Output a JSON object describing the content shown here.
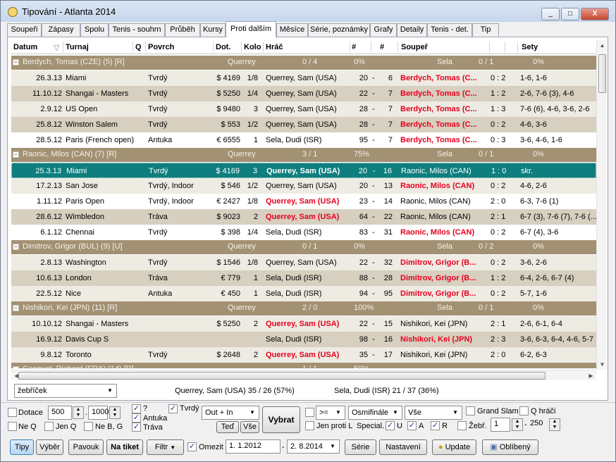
{
  "window": {
    "title": "Tipování - Atlanta 2014",
    "controls": [
      "_",
      "□",
      "X"
    ]
  },
  "tabs": [
    "Soupeři",
    "Zápasy",
    "Spolu",
    "Tenis - souhrn",
    "Průběh",
    "Kursy",
    "Proti dalším",
    "Měsíce",
    "Série, poznámky",
    "Grafy",
    "Detaily",
    "Tenis - det.",
    "Tip"
  ],
  "active_tab": "Proti dalším",
  "columns": [
    "Datum",
    "Turnaj",
    "Q",
    "Povrch",
    "Dot.",
    "Kolo",
    "Hráč",
    "#",
    "#",
    "Soupeř",
    "Sety"
  ],
  "groups": [
    {
      "header": {
        "name": "Berdych, Tomas (CZE) (5) [R]",
        "p1": "Querrey",
        "s1": "0 / 4",
        "pc1": "0%",
        "p2": "Sela",
        "s2": "0 / 1",
        "pc2": "0%"
      },
      "rows": [
        {
          "date": "26.3.13",
          "tour": "Miami",
          "surface": "Tvrdý",
          "prize": "$ 4169",
          "round": "1/8",
          "player": "Querrey, Sam (USA)",
          "n1": "20",
          "n2": "6",
          "opp": "Berdych, Tomas (C...",
          "res": "0  :  2",
          "sets": "1-6, 1-6",
          "opp_red": true,
          "player_red": false,
          "style": "r-a"
        },
        {
          "date": "11.10.12",
          "tour": "Shangai - Masters",
          "surface": "Tvrdý",
          "prize": "$ 5250",
          "round": "1/4",
          "player": "Querrey, Sam (USA)",
          "n1": "22",
          "n2": "7",
          "opp": "Berdych, Tomas (C...",
          "res": "1  :  2",
          "sets": "2-6, 7-6 (3), 4-6",
          "opp_red": true,
          "player_red": false,
          "style": "r-b"
        },
        {
          "date": "2.9.12",
          "tour": "US Open",
          "surface": "Tvrdý",
          "prize": "$ 9480",
          "round": "3",
          "player": "Querrey, Sam (USA)",
          "n1": "28",
          "n2": "7",
          "opp": "Berdych, Tomas (C...",
          "res": "1  :  3",
          "sets": "7-6 (6), 4-6, 3-6, 2-6",
          "opp_red": true,
          "player_red": false,
          "style": "r-a"
        },
        {
          "date": "25.8.12",
          "tour": "Winston Salem",
          "surface": "Tvrdý",
          "prize": "$ 553",
          "round": "1/2",
          "player": "Querrey, Sam (USA)",
          "n1": "28",
          "n2": "7",
          "opp": "Berdych, Tomas (C...",
          "res": "0  :  2",
          "sets": "4-6, 3-6",
          "opp_red": true,
          "player_red": false,
          "style": "r-b"
        },
        {
          "date": "28.5.12",
          "tour": "Paris (French open)",
          "surface": "Antuka",
          "prize": "€ 6555",
          "round": "1",
          "player": "Sela, Dudi (ISR)",
          "n1": "95",
          "n2": "7",
          "opp": "Berdych, Tomas (C...",
          "res": "0  :  3",
          "sets": "3-6, 4-6, 1-6",
          "opp_red": true,
          "player_red": false,
          "style": "r-c"
        }
      ]
    },
    {
      "header": {
        "name": "Raonic, Milos (CAN) (7) [R]",
        "p1": "Querrey",
        "s1": "3 / 1",
        "pc1": "75%",
        "p2": "Sela",
        "s2": "0 / 1",
        "pc2": "0%"
      },
      "rows": [
        {
          "date": "25.3.13",
          "tour": "Miami",
          "surface": "Tvrdý",
          "prize": "$ 4169",
          "round": "3",
          "player": "Querrey, Sam (USA)",
          "n1": "20",
          "n2": "16",
          "opp": "Raonic, Milos (CAN)",
          "res": "1  :  0",
          "sets": "skr.",
          "opp_red": false,
          "player_red": false,
          "player_bold": true,
          "style": "r-sel"
        },
        {
          "date": "17.2.13",
          "tour": "San Jose",
          "surface": "Tvrdý, Indoor",
          "prize": "$ 546",
          "round": "1/2",
          "player": "Querrey, Sam (USA)",
          "n1": "20",
          "n2": "13",
          "opp": "Raonic, Milos (CAN)",
          "res": "0  :  2",
          "sets": "4-6, 2-6",
          "opp_red": true,
          "player_red": false,
          "style": "r-a"
        },
        {
          "date": "1.11.12",
          "tour": "Paris Open",
          "surface": "Tvrdý, Indoor",
          "prize": "€ 2427",
          "round": "1/8",
          "player": "Querrey, Sam (USA)",
          "n1": "23",
          "n2": "14",
          "opp": "Raonic, Milos (CAN)",
          "res": "2  :  0",
          "sets": "6-3, 7-6 (1)",
          "opp_red": false,
          "player_red": true,
          "style": "r-c"
        },
        {
          "date": "28.6.12",
          "tour": "Wimbledon",
          "surface": "Tráva",
          "prize": "$ 9023",
          "round": "2",
          "player": "Querrey, Sam (USA)",
          "n1": "64",
          "n2": "22",
          "opp": "Raonic, Milos (CAN)",
          "res": "2  :  1",
          "sets": "6-7 (3), 7-6 (7), 7-6 (...",
          "opp_red": false,
          "player_red": true,
          "style": "r-b"
        },
        {
          "date": "6.1.12",
          "tour": "Chennai",
          "surface": "Tvrdý",
          "prize": "$ 398",
          "round": "1/4",
          "player": "Sela, Dudi (ISR)",
          "n1": "83",
          "n2": "31",
          "opp": "Raonic, Milos (CAN)",
          "res": "0  :  2",
          "sets": "6-7 (4), 3-6",
          "opp_red": true,
          "player_red": false,
          "style": "r-c"
        }
      ]
    },
    {
      "header": {
        "name": "Dimitrov, Grigor (BUL) (9) [U]",
        "p1": "Querrey",
        "s1": "0 / 1",
        "pc1": "0%",
        "p2": "Sela",
        "s2": "0 / 2",
        "pc2": "0%"
      },
      "rows": [
        {
          "date": "2.8.13",
          "tour": "Washington",
          "surface": "Tvrdý",
          "prize": "$ 1546",
          "round": "1/8",
          "player": "Querrey, Sam (USA)",
          "n1": "22",
          "n2": "32",
          "opp": "Dimitrov, Grigor (B...",
          "res": "0  :  2",
          "sets": "3-6, 2-6",
          "opp_red": true,
          "player_red": false,
          "style": "r-a"
        },
        {
          "date": "10.6.13",
          "tour": "London",
          "surface": "Tráva",
          "prize": "€ 779",
          "round": "1",
          "player": "Sela, Dudi (ISR)",
          "n1": "88",
          "n2": "28",
          "opp": "Dimitrov, Grigor (B...",
          "res": "1  :  2",
          "sets": "6-4, 2-6, 6-7 (4)",
          "opp_red": true,
          "player_red": false,
          "style": "r-b"
        },
        {
          "date": "22.5.12",
          "tour": "Nice",
          "surface": "Antuka",
          "prize": "€ 450",
          "round": "1",
          "player": "Sela, Dudi (ISR)",
          "n1": "94",
          "n2": "95",
          "opp": "Dimitrov, Grigor (B...",
          "res": "0  :  2",
          "sets": "5-7, 1-6",
          "opp_red": true,
          "player_red": false,
          "style": "r-a"
        }
      ]
    },
    {
      "header": {
        "name": "Nishikori, Kei (JPN) (11) [R]",
        "p1": "Querrey",
        "s1": "2 / 0",
        "pc1": "100%",
        "p2": "Sela",
        "s2": "0 / 1",
        "pc2": "0%"
      },
      "rows": [
        {
          "date": "10.10.12",
          "tour": "Shangai - Masters",
          "surface": "",
          "prize": "$ 5250",
          "round": "2",
          "player": "Querrey, Sam (USA)",
          "n1": "22",
          "n2": "15",
          "opp": "Nishikori, Kei (JPN)",
          "res": "2  :  1",
          "sets": "2-6, 6-1, 6-4",
          "opp_red": false,
          "player_red": true,
          "style": "r-a"
        },
        {
          "date": "16.9.12",
          "tour": "Davis Cup S",
          "surface": "",
          "prize": "",
          "round": "",
          "player": "Sela, Dudi (ISR)",
          "n1": "98",
          "n2": "16",
          "opp": "Nishikori, Kei (JPN)",
          "res": "2  :  3",
          "sets": "3-6, 6-3, 6-4, 4-6, 5-7",
          "opp_red": true,
          "player_red": false,
          "style": "r-b"
        },
        {
          "date": "9.8.12",
          "tour": "Toronto",
          "surface": "Tvrdý",
          "prize": "$ 2648",
          "round": "2",
          "player": "Querrey, Sam (USA)",
          "n1": "35",
          "n2": "17",
          "opp": "Nishikori, Kei (JPN)",
          "res": "2  :  0",
          "sets": "6-2, 6-3",
          "opp_red": false,
          "player_red": true,
          "style": "r-a"
        }
      ]
    }
  ],
  "partial_group": {
    "name": "Gasquet, Richard (FRA) (14) [R]",
    "s1": "1 / 1",
    "pc1": "50%"
  },
  "summary": {
    "ranking_label": "žebříček",
    "player1": "Querrey, Sam (USA)  35 / 26  (57%)",
    "player2": "Sela, Dudi (ISR)  21 / 37  (36%)"
  },
  "filters": {
    "dotace_label": "Dotace",
    "dotace_from": "500",
    "dotace_to": "1000",
    "neq_label": "Ne Q",
    "jenq_label": "Jen Q",
    "nebg_label": "Ne B, G",
    "q_label": "?",
    "antuka_label": "Antuka",
    "trava_label": "Tráva",
    "tvrdy_label": "Tvrdý",
    "out_in_value": "Out + In",
    "ted_label": "Teď",
    "vse_label": "Vše",
    "vybrat_label": "Vybrat",
    "op_value": ">=",
    "round_value": "Osmifinále",
    "all_value": "Vše",
    "jen_proti_label": "Jen proti L",
    "special_label": "Special.",
    "u_label": "U",
    "a_label": "A",
    "r_label": "R",
    "grand_slam_label": "Grand Slam",
    "q_hraci_label": "Q hráči",
    "zebr_label": "Žebř.",
    "zebr_from": "1",
    "zebr_to": "250"
  },
  "bottom": {
    "tipy": "Tipy",
    "vyber": "Výběr",
    "pavouk": "Pavouk",
    "na_tiket": "Na tiket",
    "filtr": "Filtr",
    "omezit": "Omezit",
    "date_from": "1.  1.2012",
    "date_to": "2.  8.2014",
    "dash": "-",
    "serie": "Série",
    "nastaveni": "Nastavení",
    "update": "Update",
    "oblibene": "Oblíbený"
  }
}
